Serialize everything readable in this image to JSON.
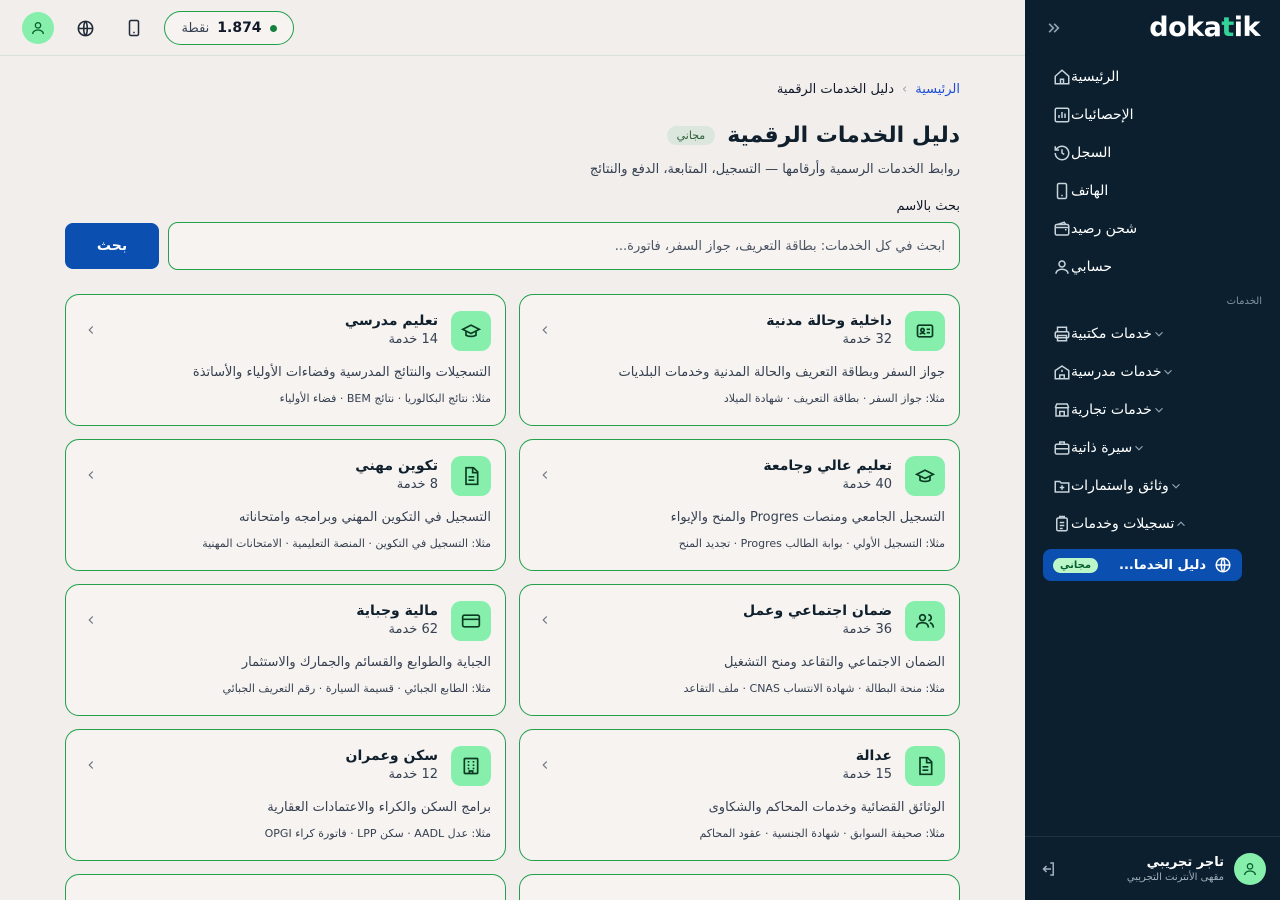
{
  "app": {
    "logo_main": "doka",
    "logo_accent": "t",
    "logo_end": "ik"
  },
  "topbar": {
    "points_value": "1.874",
    "points_unit": "نقطة"
  },
  "sidebar": {
    "main_items": [
      {
        "label": "الرئيسية",
        "icon": "home-icon"
      },
      {
        "label": "الإحصائيات",
        "icon": "bar-chart-icon"
      },
      {
        "label": "السجل",
        "icon": "history-icon"
      },
      {
        "label": "الهاتف",
        "icon": "phone-icon"
      },
      {
        "label": "شحن رصيد",
        "icon": "wallet-icon"
      },
      {
        "label": "حسابي",
        "icon": "user-icon"
      }
    ],
    "section_title": "الخدمات",
    "service_items": [
      {
        "label": "خدمات مكتبية",
        "icon": "printer-icon"
      },
      {
        "label": "خدمات مدرسية",
        "icon": "school-icon"
      },
      {
        "label": "خدمات تجارية",
        "icon": "store-icon"
      },
      {
        "label": "سيرة ذاتية",
        "icon": "briefcase-icon"
      },
      {
        "label": "وثائق واستمارات",
        "icon": "folder-icon"
      },
      {
        "label": "تسجيلات وخدمات",
        "icon": "clipboard-icon"
      }
    ],
    "active_item": {
      "label": "دليل الخدما...",
      "badge": "مجاني",
      "icon": "globe-icon"
    },
    "user": {
      "name": "تاجر تجريبي",
      "subtitle": "مقهى الأنترنت التجريبي"
    }
  },
  "breadcrumb": {
    "home": "الرئيسية",
    "current": "دليل الخدمات الرقمية"
  },
  "page": {
    "title": "دليل الخدمات الرقمية",
    "badge": "مجاني",
    "subtitle": "روابط الخدمات الرسمية وأرقامها — التسجيل، المتابعة، الدفع والنتائج"
  },
  "search": {
    "label": "بحث بالاسم",
    "placeholder": "ابحث في كل الخدمات: بطاقة التعريف، جواز السفر، فاتورة...",
    "button": "بحث"
  },
  "cards": [
    {
      "title": "داخلية وحالة مدنية",
      "count": "32 خدمة",
      "desc": "جواز السفر وبطاقة التعريف والحالة المدنية وخدمات البلديات",
      "examples": "مثلا: جواز السفر · بطاقة التعريف · شهادة الميلاد",
      "icon": "id-card-icon"
    },
    {
      "title": "تعليم مدرسي",
      "count": "14 خدمة",
      "desc": "التسجيلات والنتائج المدرسية وفضاءات الأولياء والأساتذة",
      "examples": "مثلا: نتائج البكالوريا · نتائج BEM · فضاء الأولياء",
      "icon": "graduation-cap-icon"
    },
    {
      "title": "تعليم عالي وجامعة",
      "count": "40 خدمة",
      "desc": "التسجيل الجامعي ومنصات Progres والمنح والإيواء",
      "examples": "مثلا: التسجيل الأولي · بوابة الطالب Progres · تجديد المنح",
      "icon": "graduation-cap-icon"
    },
    {
      "title": "تكوين مهني",
      "count": "8 خدمة",
      "desc": "التسجيل في التكوين المهني وبرامجه وامتحاناته",
      "examples": "مثلا: التسجيل في التكوين · المنصة التعليمية · الامتحانات المهنية",
      "icon": "document-icon"
    },
    {
      "title": "ضمان اجتماعي وعمل",
      "count": "36 خدمة",
      "desc": "الضمان الاجتماعي والتقاعد ومنح التشغيل",
      "examples": "مثلا: منحة البطالة · شهادة الانتساب CNAS · ملف التقاعد",
      "icon": "users-icon"
    },
    {
      "title": "مالية وجباية",
      "count": "62 خدمة",
      "desc": "الجباية والطوابع والقسائم والجمارك والاستثمار",
      "examples": "مثلا: الطابع الجبائي · قسيمة السيارة · رقم التعريف الجبائي",
      "icon": "credit-card-icon"
    },
    {
      "title": "عدالة",
      "count": "15 خدمة",
      "desc": "الوثائق القضائية وخدمات المحاكم والشكاوى",
      "examples": "مثلا: صحيفة السوابق · شهادة الجنسية · عقود المحاكم",
      "icon": "document-icon"
    },
    {
      "title": "سكن وعمران",
      "count": "12 خدمة",
      "desc": "برامج السكن والكراء والاعتمادات العقارية",
      "examples": "مثلا: عدل AADL · سكن LPP · فاتورة كراء OPGI",
      "icon": "building-icon"
    }
  ]
}
